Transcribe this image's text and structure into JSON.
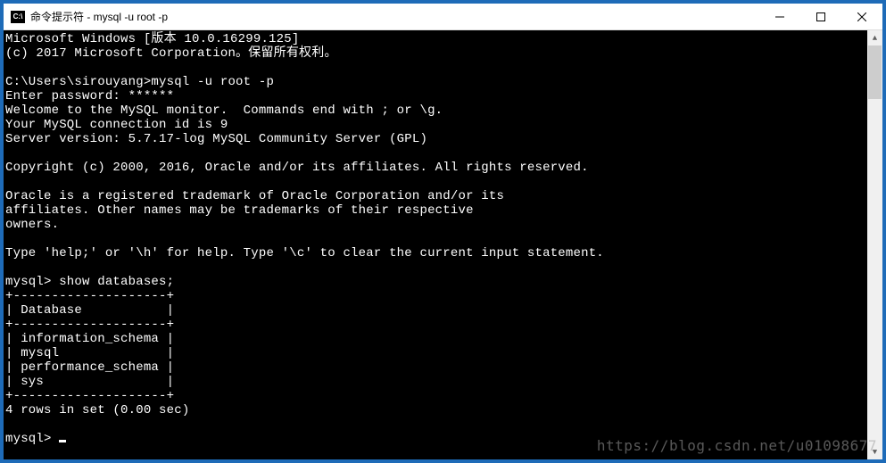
{
  "window": {
    "icon_label": "C:\\",
    "title": "命令提示符 - mysql  -u root -p"
  },
  "terminal": {
    "lines": [
      "Microsoft Windows [版本 10.0.16299.125]",
      "(c) 2017 Microsoft Corporation。保留所有权利。",
      "",
      "C:\\Users\\sirouyang>mysql -u root -p",
      "Enter password: ******",
      "Welcome to the MySQL monitor.  Commands end with ; or \\g.",
      "Your MySQL connection id is 9",
      "Server version: 5.7.17-log MySQL Community Server (GPL)",
      "",
      "Copyright (c) 2000, 2016, Oracle and/or its affiliates. All rights reserved.",
      "",
      "Oracle is a registered trademark of Oracle Corporation and/or its",
      "affiliates. Other names may be trademarks of their respective",
      "owners.",
      "",
      "Type 'help;' or '\\h' for help. Type '\\c' to clear the current input statement.",
      "",
      "mysql> show databases;",
      "+--------------------+",
      "| Database           |",
      "+--------------------+",
      "| information_schema |",
      "| mysql              |",
      "| performance_schema |",
      "| sys                |",
      "+--------------------+",
      "4 rows in set (0.00 sec)",
      "",
      "mysql> "
    ]
  },
  "watermark": "https://blog.csdn.net/u01098677"
}
